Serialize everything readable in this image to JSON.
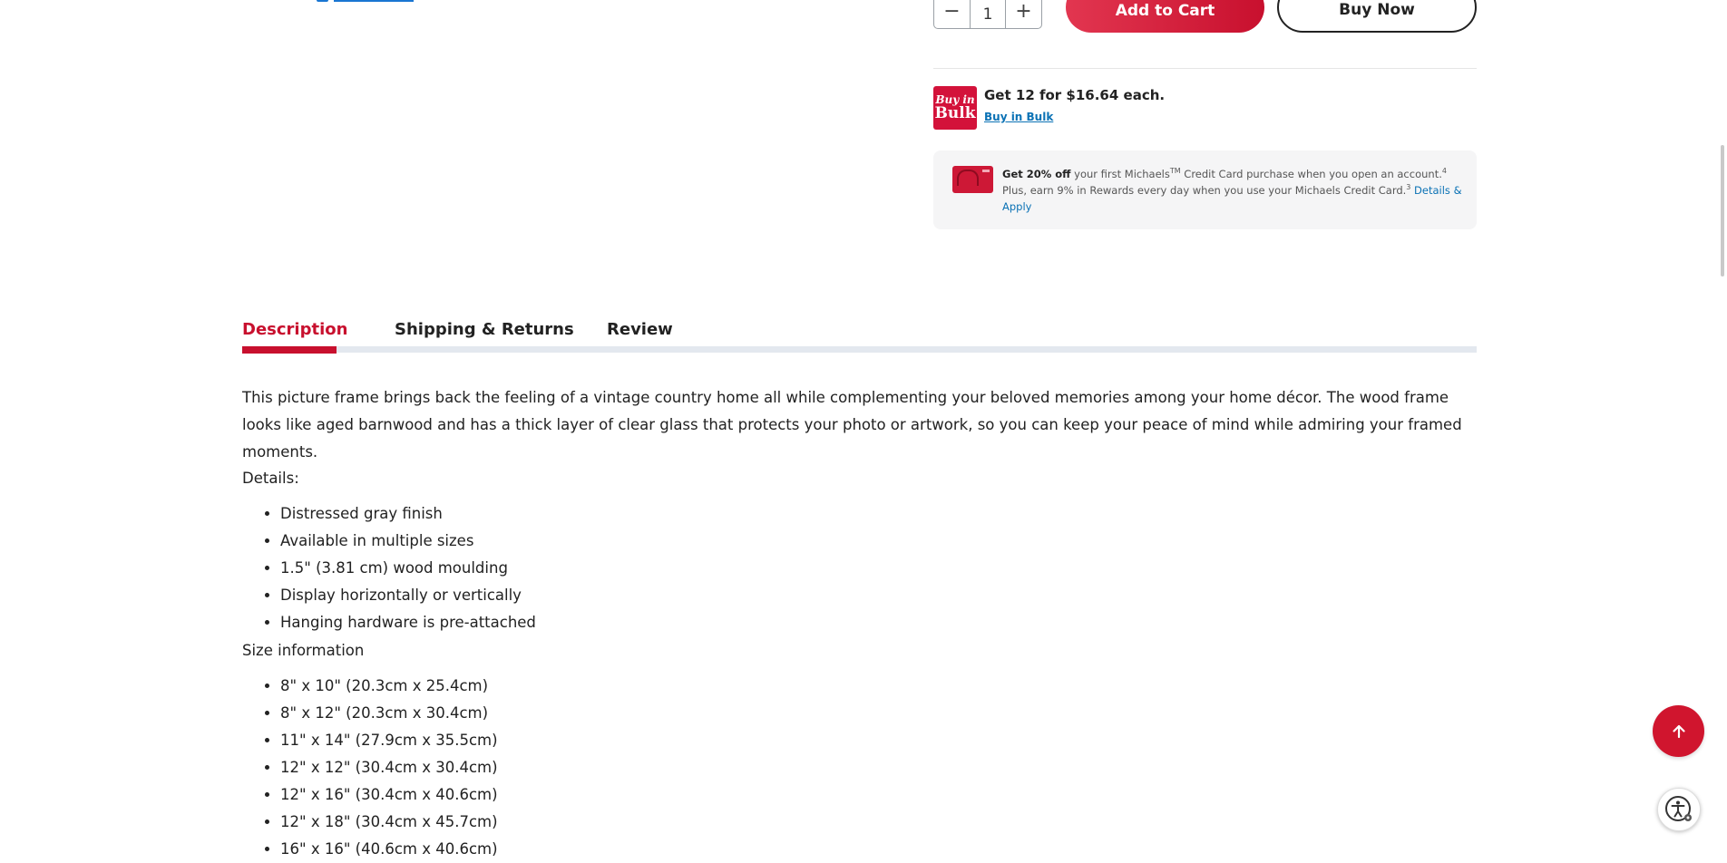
{
  "purchase": {
    "quantity": "1",
    "decrement_symbol": "−",
    "increment_symbol": "+",
    "add_to_cart_label": "Add to Cart",
    "buy_now_label": "Buy Now"
  },
  "bulk": {
    "badge_line1": "Buy in",
    "badge_line2": "Bulk",
    "title": "Get 12 for $16.64 each.",
    "link": "Buy in Bulk"
  },
  "promo": {
    "bold": "Get 20% off",
    "text1": " your first Michaels",
    "tm": "TM",
    "text2": " Credit Card purchase when you open an account.",
    "sup1": "4",
    "text3": " Plus, earn 9% in Rewards every day when you use your Michaels Credit Card.",
    "sup2": "3",
    "link": " Details & Apply"
  },
  "tabs": [
    {
      "label": "Description"
    },
    {
      "label": "Shipping & Returns"
    },
    {
      "label": "Review"
    }
  ],
  "description": {
    "paragraph": "This picture frame brings back the feeling of a vintage country home all while complementing your beloved memories among your home décor. The wood frame looks like aged barnwood and has a thick layer of clear glass that protects your photo or artwork, so you can keep your peace of mind while admiring your framed moments.",
    "details_label": "Details:",
    "details": [
      "Distressed gray finish",
      "Available in multiple sizes",
      "1.5\" (3.81 cm) wood moulding",
      "Display horizontally or vertically",
      "Hanging hardware is pre-attached"
    ],
    "size_label": "Size information",
    "sizes": [
      "8\" x 10\" (20.3cm x 25.4cm)",
      "8\" x 12\" (20.3cm x 30.4cm)",
      "11\" x 14\" (27.9cm x 35.5cm)",
      "12\" x 12\" (30.4cm x 30.4cm)",
      "12\" x 16\" (30.4cm x 40.6cm)",
      "12\" x 18\" (30.4cm x 45.7cm)",
      "16\" x 16\" (40.6cm x 40.6cm)"
    ]
  },
  "icons": {
    "back_to_top": "arrow-up-icon",
    "accessibility": "accessibility-icon"
  },
  "colors": {
    "brand_red": "#c8102e",
    "link_blue": "#0b72b5"
  }
}
